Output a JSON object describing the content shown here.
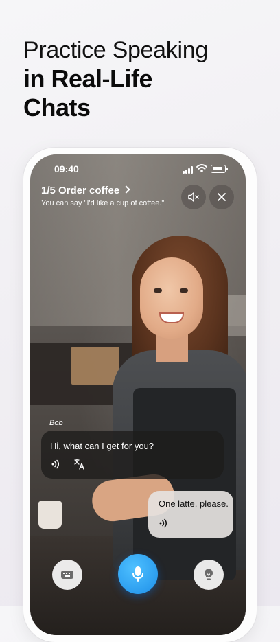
{
  "hero": {
    "line1": "Practice Speaking",
    "line2": "in Real-Life",
    "line3": "Chats"
  },
  "status_bar": {
    "time": "09:40"
  },
  "lesson": {
    "title": "1/5 Order coffee",
    "hint": "You can say \"I'd like a cup of coffee.\""
  },
  "icons": {
    "mute": "speaker-muted-icon",
    "close": "close-icon",
    "keyboard": "keyboard-icon",
    "mic": "microphone-icon",
    "tip": "lightbulb-icon"
  },
  "chat": {
    "speaker_name": "Bob",
    "bot_message": "Hi, what can I get for you?",
    "user_message": "One latte, please."
  },
  "colors": {
    "mic_button": "#1e8fe8",
    "bot_bubble": "#1e1c1b",
    "user_bubble": "#e6e2e0"
  }
}
